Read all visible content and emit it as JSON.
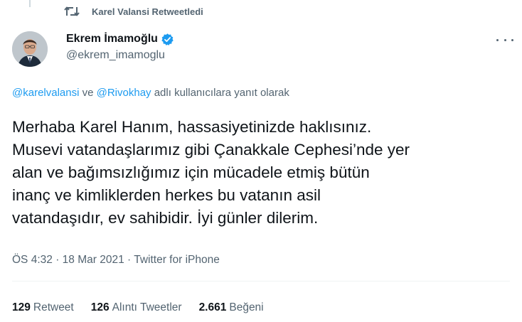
{
  "retweet_context": {
    "text": "Karel Valansi Retweetledi",
    "icon": "retweet-icon"
  },
  "author": {
    "display_name": "Ekrem İmamoğlu",
    "handle": "@ekrem_imamoglu",
    "verified": true,
    "verified_color": "#1d9bf0"
  },
  "reply_context": {
    "mention_1": "@karelvalansi",
    "connector": "ve",
    "mention_2": "@Rivokhay",
    "suffix": "adlı kullanıcılara yanıt olarak"
  },
  "tweet": {
    "lines": [
      "Merhaba Karel Hanım, hassasiyetinizde haklısınız.",
      "Musevi vatandaşlarımız gibi Çanakkale Cephesi’nde yer",
      "alan ve bağımsızlığımız için mücadele etmiş bütün",
      "inanç ve kimliklerden herkes bu vatanın asil",
      "vatandaşıdır, ev sahibidir. İyi günler dilerim."
    ]
  },
  "meta": {
    "time": "ÖS 4:32",
    "separator": "·",
    "date": "18 Mar 2021",
    "source": "Twitter for iPhone"
  },
  "stats": {
    "retweets_count": "129",
    "retweets_label": "Retweet",
    "quotes_count": "126",
    "quotes_label": "Alıntı Tweetler",
    "likes_count": "2.661",
    "likes_label": "Beğeni"
  },
  "colors": {
    "link": "#1d9bf0",
    "secondary_text": "#536471",
    "primary_text": "#0f1419"
  }
}
